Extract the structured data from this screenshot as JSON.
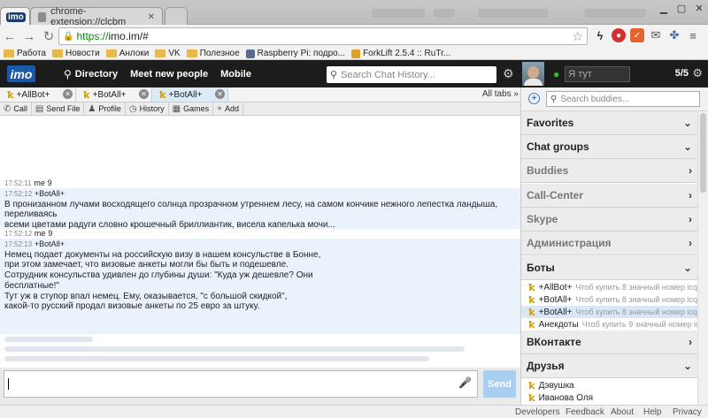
{
  "browser": {
    "tabs": [
      {
        "label": "imo"
      },
      {
        "label": "chrome-extension://clcbm"
      },
      {
        "label": ""
      }
    ],
    "url_scheme": "https://",
    "url_rest": "imo.im/#",
    "bookmarks": [
      "Работа",
      "Новости",
      "Анлоки",
      "VK",
      "Полезное",
      "Raspberry Pi: подро...",
      "ForkLift 2.5.4 :: RuTr..."
    ]
  },
  "header": {
    "logo": "imo",
    "nav": [
      "Directory",
      "Meet new people",
      "Mobile"
    ],
    "search_placeholder": "Search Chat History..."
  },
  "profile": {
    "status_text": "Я тут",
    "count": "5/5"
  },
  "chat_tabs": {
    "tabs": [
      "+AllBot+",
      "+BotAll+",
      "+BotAll+"
    ],
    "all_tabs": "All tabs »"
  },
  "actions": [
    "Call",
    "Send File",
    "Profile",
    "History",
    "Games",
    "Add"
  ],
  "messages": [
    {
      "time": "17:52:11",
      "sender": "me",
      "text": "9",
      "kind": "me"
    },
    {
      "time": "17:52:12",
      "sender": "+BotAll+",
      "kind": "bot",
      "lines": [
        "В пронизанном лучами восходящего солнца прозрачном утреннем лесу, на самом кончике нежного лепестка ландыша, переливаясь",
        "всеми цветами радуги словно крошечный бриллиантик, висела капелька мочи..."
      ]
    },
    {
      "time": "17:52:12",
      "sender": "me",
      "text": "9",
      "kind": "me"
    },
    {
      "time": "17:52:13",
      "sender": "+BotAll+",
      "kind": "bot",
      "lines": [
        "Немец подает документы на российскую визу в нашем консульстве в Бонне,",
        "при этом замечает, что визовые анкеты могли бы быть и подешевле.",
        "Сотрудник консульства удивлен до глубины души: \"Куда уж дешевле? Они",
        "бесплатные!\"",
        "Тут уж в ступор впал немец. Ему, оказывается, \"с большой скидкой\",",
        "какой-то русский продал визовые анкеты по 25 евро за штуку."
      ]
    }
  ],
  "compose": {
    "send_label": "Send"
  },
  "sidebar": {
    "search_placeholder": "Search buddies...",
    "groups": [
      {
        "name": "Favorites",
        "state": "open"
      },
      {
        "name": "Chat groups",
        "state": "open"
      },
      {
        "name": "Buddies",
        "state": "closed"
      },
      {
        "name": "Call-Center",
        "state": "closed"
      },
      {
        "name": "Skype",
        "state": "closed"
      },
      {
        "name": "Администрация",
        "state": "closed"
      },
      {
        "name": "Боты",
        "state": "open"
      },
      {
        "name": "ВКонтакте",
        "state": "closed"
      },
      {
        "name": "Друзья",
        "state": "open"
      }
    ],
    "bots": [
      {
        "name": "+AllBot+",
        "status": "Чтоб купить 8 значный номер icq"
      },
      {
        "name": "+BotAll+",
        "status": "Чтоб купить 8 значный номер icq"
      },
      {
        "name": "+BotAll+",
        "status": "Чтоб купить 8 значный номер icq"
      },
      {
        "name": "Анекдоты",
        "status": "Чтоб купить 9 значный номер icq"
      }
    ],
    "friends": [
      {
        "name": "Дэвушка"
      },
      {
        "name": "Иванова Оля"
      }
    ]
  },
  "footer": [
    "Developers",
    "Feedback",
    "About",
    "Help",
    "Privacy"
  ]
}
